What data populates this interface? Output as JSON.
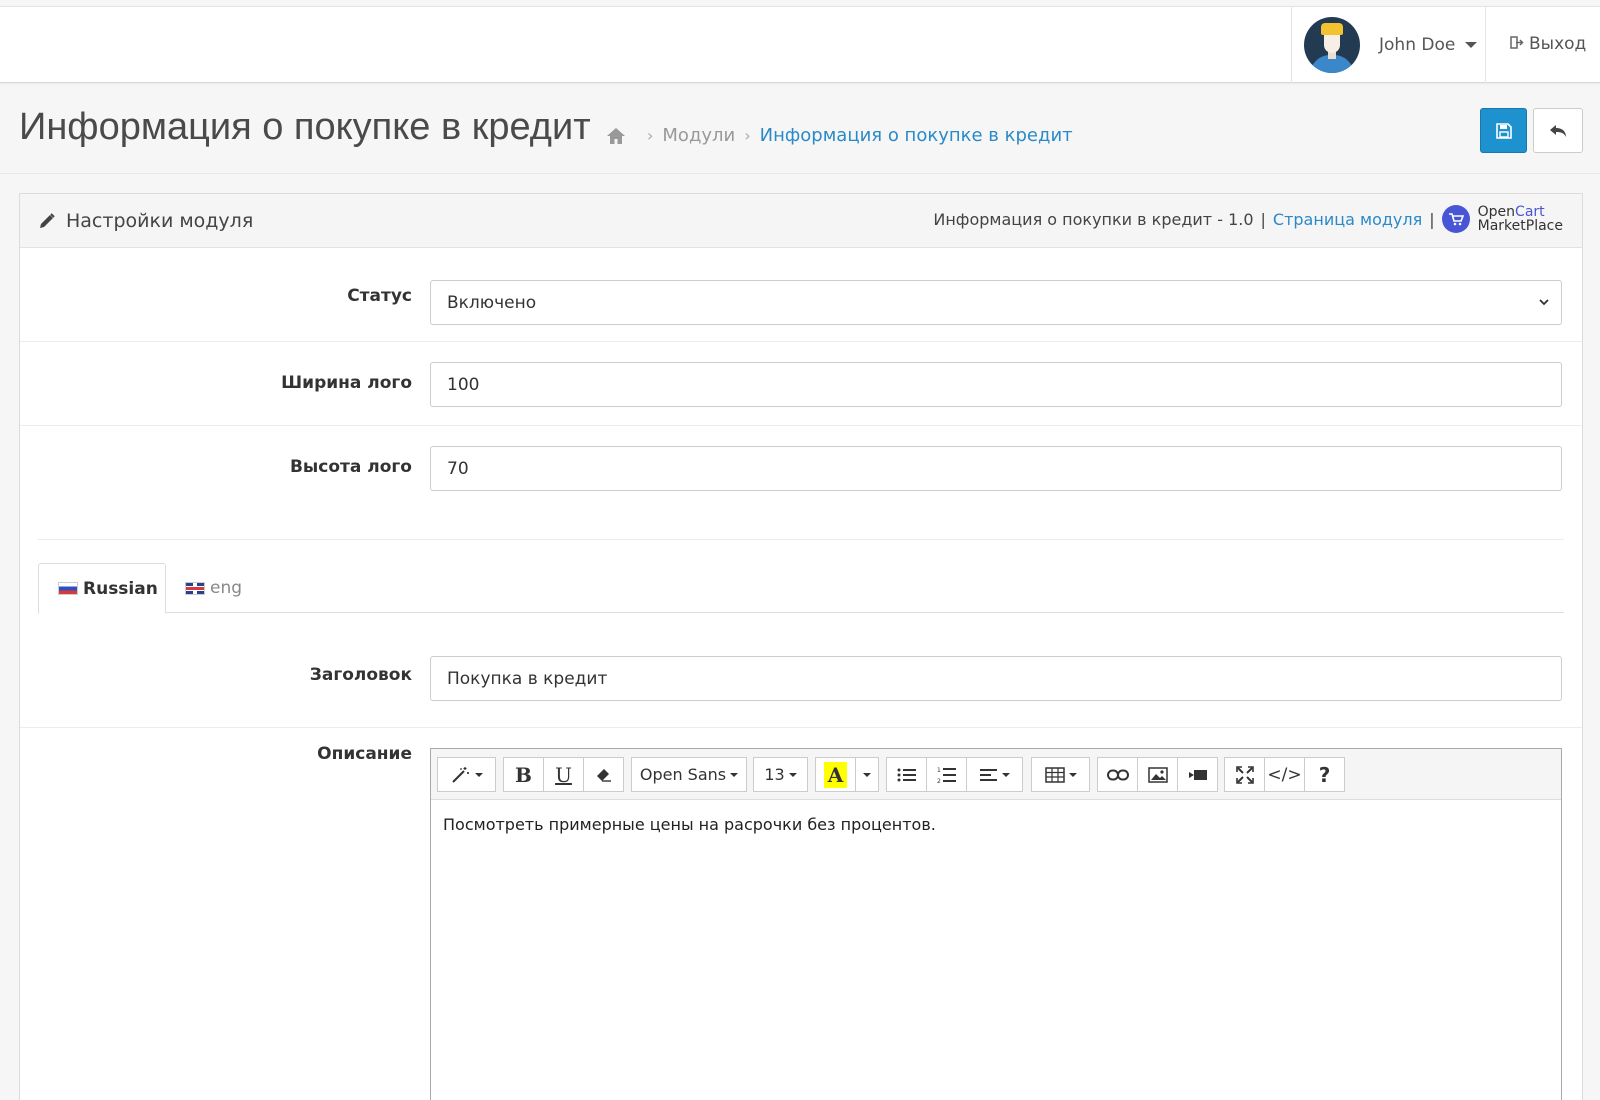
{
  "header": {
    "user_name": "John Doe",
    "logout_label": "Выход"
  },
  "page": {
    "title": "Информация о покупке в кредит",
    "breadcrumb": [
      "Модули",
      "Информация о покупке в кредит"
    ]
  },
  "panel": {
    "title": "Настройки модуля",
    "module_info": "Информация о покупки в кредит - 1.0",
    "module_link": "Страница модуля",
    "marketplace_line1_a": "Open",
    "marketplace_line1_b": "Cart",
    "marketplace_line2": "MarketPlace"
  },
  "form": {
    "status_label": "Статус",
    "status_value": "Включено",
    "logo_width_label": "Ширина лого",
    "logo_width_value": "100",
    "logo_height_label": "Высота лого",
    "logo_height_value": "70"
  },
  "tabs": [
    {
      "label": "Russian",
      "active": true
    },
    {
      "label": "eng",
      "active": false
    }
  ],
  "lang_form": {
    "heading_label": "Заголовок",
    "heading_value": "Покупка в кредит",
    "description_label": "Описание",
    "description_text": "Посмотреть примерные цены на расрочки без процентов."
  },
  "editor_toolbar": {
    "font_name": "Open Sans",
    "font_size": "13"
  },
  "colors": {
    "primary": "#1e91cf",
    "link": "#2a8ac8",
    "marketplace": "#4856d6",
    "highlight": "#ffff00"
  }
}
